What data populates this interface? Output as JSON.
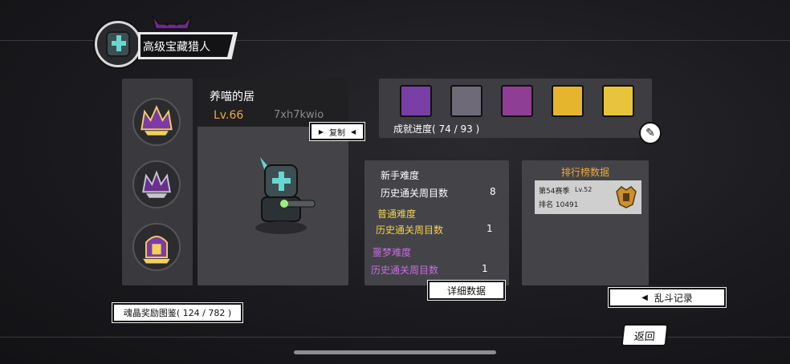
{
  "header": {
    "title": "高级宝藏猎人"
  },
  "character": {
    "name": "养喵的居",
    "level": "Lv.66",
    "id": "7xh7kwio",
    "copy_label": "复制"
  },
  "achievements": {
    "progress": "成就进度( 74 / 93 )",
    "icons": [
      "purple-dragon-icon",
      "skull-cart-icon",
      "pink-crystal-icon",
      "gold-treasure-icon",
      "gold-scepter-icon"
    ]
  },
  "difficulty": {
    "novice": {
      "title": "新手难度",
      "label": "历史通关周目数",
      "value": "8"
    },
    "normal": {
      "title": "普通难度",
      "label": "历史通关周目数",
      "value": "1"
    },
    "nightmare": {
      "title": "噩梦难度",
      "label": "历史通关周目数",
      "value": "1"
    },
    "detail_label": "详细数据"
  },
  "leaderboard": {
    "title": "排行榜数据",
    "season": "第54赛季",
    "level": "Lv.52",
    "rank": "排名 10491"
  },
  "buttons": {
    "brawl": "乱斗记录",
    "soul": "魂晶奖励图鉴( 124 / 782 )",
    "back": "返回"
  },
  "colors": {
    "accent_orange": "#f0a93a",
    "normal_yellow": "#f2d14a",
    "nightmare_purple": "#c66de0",
    "teal": "#66d7d2"
  }
}
